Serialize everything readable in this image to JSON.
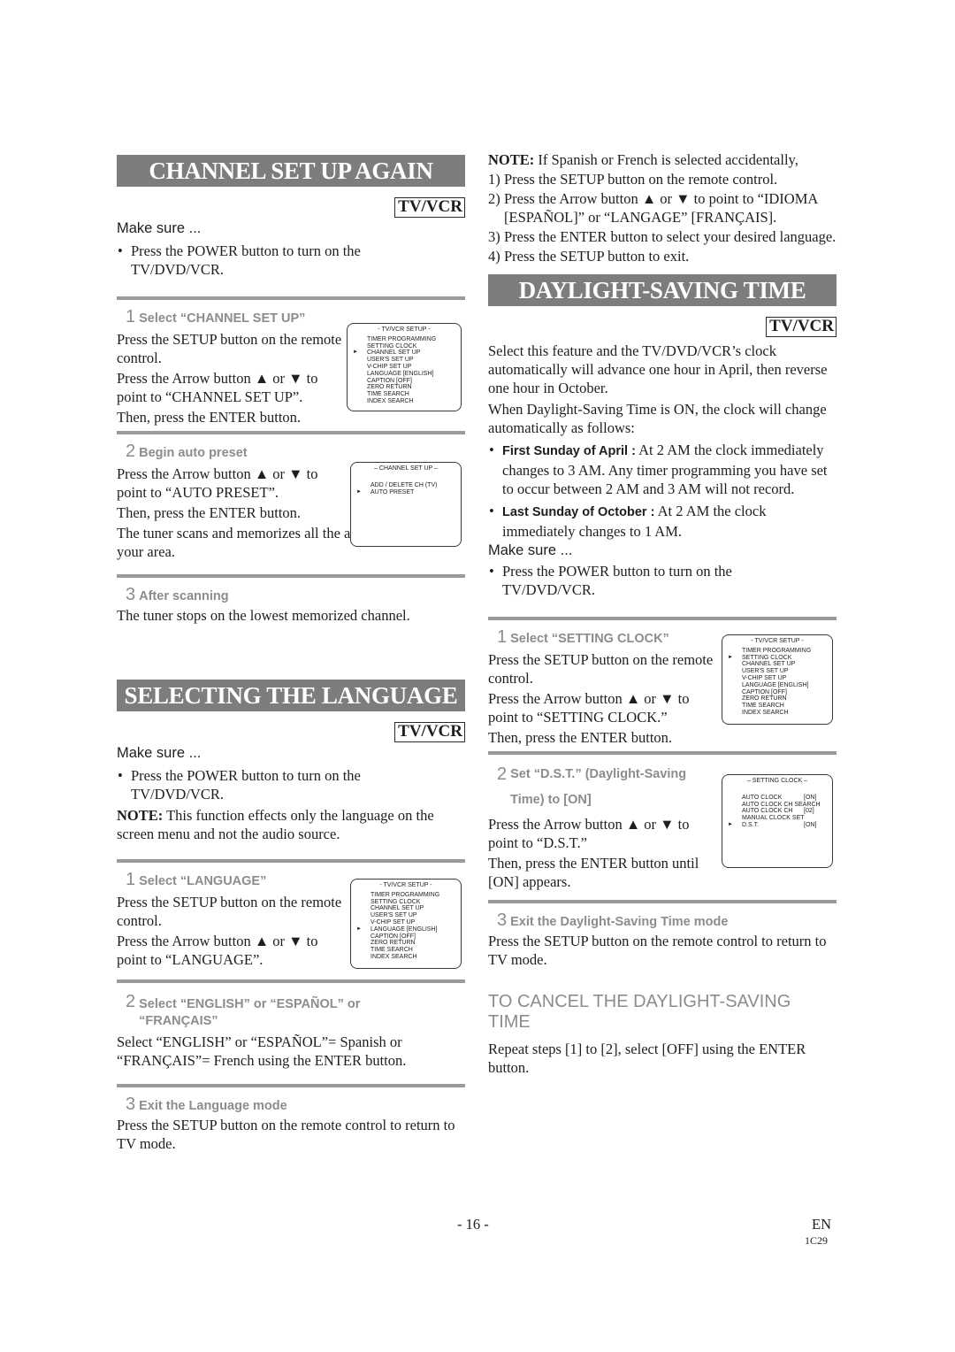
{
  "left": {
    "channel": {
      "title": "CHANNEL SET UP AGAIN",
      "tag": "TV/VCR",
      "make_sure": "Make sure ...",
      "bullet": "Press the POWER button to turn on the TV/DVD/VCR.",
      "steps": [
        {
          "num": "1",
          "heading": "Select “CHANNEL SET UP”",
          "paras": [
            "Press the SETUP button on the remote control.",
            "Press the Arrow button ▲ or ▼ to point to “CHANNEL SET UP”.",
            "Then, press the ENTER button."
          ],
          "screen": {
            "title": "- TV/VCR SETUP -",
            "items": [
              "TIMER PROGRAMMING",
              "SETTING CLOCK",
              "CHANNEL SET UP",
              "USER'S SET UP",
              "V-CHIP SET UP",
              "LANGUAGE  [ENGLISH]",
              "CAPTION  [OFF]",
              "ZERO RETURN",
              "TIME SEARCH",
              "INDEX SEARCH"
            ],
            "selected": "CHANNEL SET UP"
          }
        },
        {
          "num": "2",
          "heading": "Begin auto preset",
          "paras": [
            "Press the Arrow button ▲ or ▼ to point to “AUTO PRESET”.",
            "Then, press the ENTER button.",
            "The tuner scans and memorizes all the active channels in your area."
          ],
          "screen": {
            "title": "– CHANNEL SET UP –",
            "items": [
              "ADD / DELETE CH (TV)",
              "AUTO PRESET"
            ],
            "selected": "AUTO PRESET"
          }
        },
        {
          "num": "3",
          "heading": "After scanning",
          "paras": [
            "The tuner stops on the lowest memorized channel."
          ]
        }
      ]
    },
    "language": {
      "title": "SELECTING THE LANGUAGE",
      "tag": "TV/VCR",
      "make_sure": "Make sure ...",
      "bullet": "Press the POWER button to turn on the TV/DVD/VCR.",
      "note_label": "NOTE:",
      "note_text": "This function effects only the language on the screen menu and not the audio source.",
      "steps": [
        {
          "num": "1",
          "heading": "Select “LANGUAGE”",
          "paras": [
            "Press the SETUP button on the remote control.",
            "Press the Arrow button ▲ or ▼ to point to “LANGUAGE”."
          ],
          "screen": {
            "title": "- TV/VCR SETUP -",
            "items": [
              "TIMER PROGRAMMING",
              "SETTING CLOCK",
              "CHANNEL SET UP",
              "USER'S SET UP",
              "V-CHIP SET UP",
              "LANGUAGE   [ENGLISH]",
              "CAPTION  [OFF]",
              "ZERO RETURN",
              "TIME SEARCH",
              "INDEX SEARCH"
            ],
            "selected": "LANGUAGE   [ENGLISH]"
          }
        },
        {
          "num": "2",
          "heading": "Select “ENGLISH” or “ESPAÑOL” or “FRANÇAIS”",
          "paras": [
            "Select “ENGLISH” or “ESPAÑOL”= Spanish or “FRANÇAIS”= French using the ENTER button."
          ]
        },
        {
          "num": "3",
          "heading": "Exit the Language mode",
          "paras": [
            "Press the SETUP button on the remote control to return to TV mode."
          ]
        }
      ]
    }
  },
  "right": {
    "note": {
      "label": "NOTE:",
      "text": "If Spanish or French is selected accidentally,",
      "items": [
        {
          "n": "1)",
          "text": "Press the SETUP button on the remote control."
        },
        {
          "n": "2)",
          "text": "Press the Arrow button ▲ or ▼ to point to “IDIOMA [ESPAÑOL]” or “LANGAGE” [FRANÇAIS]."
        },
        {
          "n": "3)",
          "text": "Press the ENTER button to select your desired language."
        },
        {
          "n": "4)",
          "text": "Press the SETUP button to exit."
        }
      ]
    },
    "dst": {
      "title": "DAYLIGHT-SAVING TIME",
      "tag": "TV/VCR",
      "intro1": "Select this feature and the TV/DVD/VCR’s clock automatically will advance one hour in April, then reverse one hour in October.",
      "intro2": "When Daylight-Saving Time is ON, the clock will change automatically as follows:",
      "bullets": [
        {
          "label": "First Sunday of April :",
          "text": "At 2 AM the clock immediately changes to 3 AM. Any timer programming you have set to occur between 2 AM and 3 AM will not record."
        },
        {
          "label": "Last Sunday of October :",
          "text": "At 2 AM the clock immediately changes to 1 AM."
        }
      ],
      "make_sure": "Make sure ...",
      "power_bullet": "Press the POWER button to turn on the TV/DVD/VCR.",
      "steps": [
        {
          "num": "1",
          "heading": "Select “SETTING CLOCK”",
          "paras": [
            "Press the SETUP button on the remote control.",
            "Press the Arrow button ▲ or ▼ to point to “SETTING CLOCK.”",
            "Then, press the ENTER button."
          ],
          "screen": {
            "title": "- TV/VCR SETUP -",
            "items": [
              "TIMER PROGRAMMING",
              "SETTING CLOCK",
              "CHANNEL SET UP",
              "USER'S SET UP",
              "V-CHIP SET UP",
              "LANGUAGE  [ENGLISH]",
              "CAPTION  [OFF]",
              "ZERO RETURN",
              "TIME SEARCH",
              "INDEX SEARCH"
            ],
            "selected": "SETTING CLOCK"
          }
        },
        {
          "num": "2",
          "heading": "Set “D.S.T.” (Daylight-Saving Time) to [ON]",
          "paras": [
            "Press the Arrow button ▲ or ▼ to point to “D.S.T.”",
            "Then, press the ENTER button until [ON] appears."
          ],
          "screen": {
            "title": "– SETTING CLOCK –",
            "rows": [
              {
                "label": "AUTO CLOCK",
                "value": "[ON]"
              },
              {
                "label": "AUTO CLOCK CH SEARCH",
                "value": ""
              },
              {
                "label": "AUTO CLOCK CH",
                "value": "[02]"
              },
              {
                "label": "MANUAL CLOCK SET",
                "value": ""
              },
              {
                "label": "D.S.T.",
                "value": "[ON]"
              }
            ],
            "selected": "D.S.T."
          }
        },
        {
          "num": "3",
          "heading": "Exit the Daylight-Saving Time mode",
          "paras": [
            "Press the SETUP button on the remote control to return to TV mode."
          ]
        }
      ],
      "cancel_heading": "TO CANCEL THE DAYLIGHT-SAVING TIME",
      "cancel_text": "Repeat steps [1] to [2], select [OFF] using the ENTER button."
    }
  },
  "footer": {
    "page": "- 16 -",
    "lang": "EN",
    "code": "1C29"
  }
}
